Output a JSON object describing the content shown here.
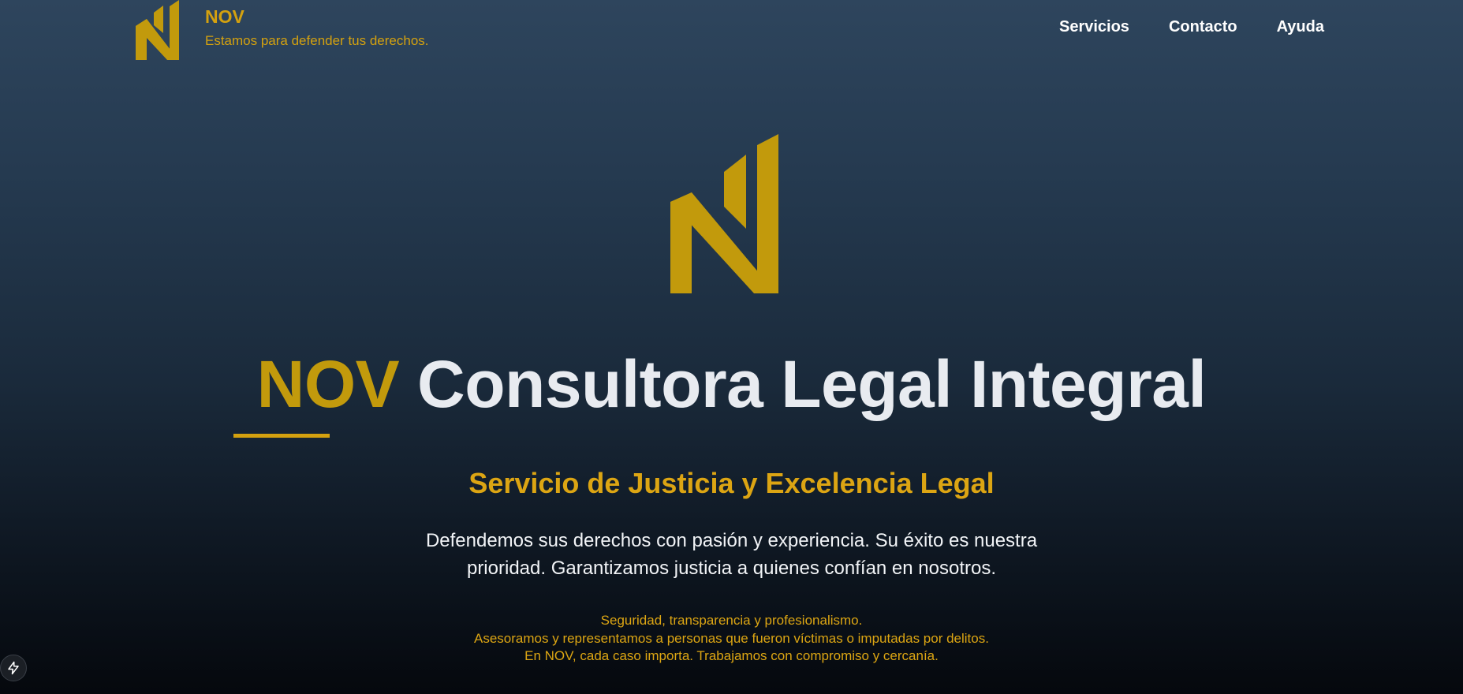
{
  "header": {
    "brand_name": "NOV",
    "tagline": "Estamos para defender tus derechos.",
    "nav": [
      {
        "label": "Servicios"
      },
      {
        "label": "Contacto"
      },
      {
        "label": "Ayuda"
      }
    ]
  },
  "hero": {
    "title_accent": "NOV",
    "title_rest": "Consultora Legal Integral",
    "subtitle": "Servicio de Justicia y Excelencia Legal",
    "description": "Defendemos sus derechos con pasión y experiencia. Su éxito es nuestra prioridad. Garantizamos justicia a quienes confían en nosotros.",
    "values": [
      "Seguridad, transparencia y profesionalismo.",
      "Asesoramos y representamos a personas que fueron víctimas o imputadas por delitos.",
      "En NOV, cada caso importa. Trabajamos con compromiso y cercanía."
    ]
  },
  "icons": {
    "logo": "nov-logo-icon",
    "floating": "bolt-icon"
  },
  "colors": {
    "accent": "#d4a10f",
    "background_top": "#2e455d",
    "background_bottom": "#05080d",
    "text": "#ffffff"
  }
}
